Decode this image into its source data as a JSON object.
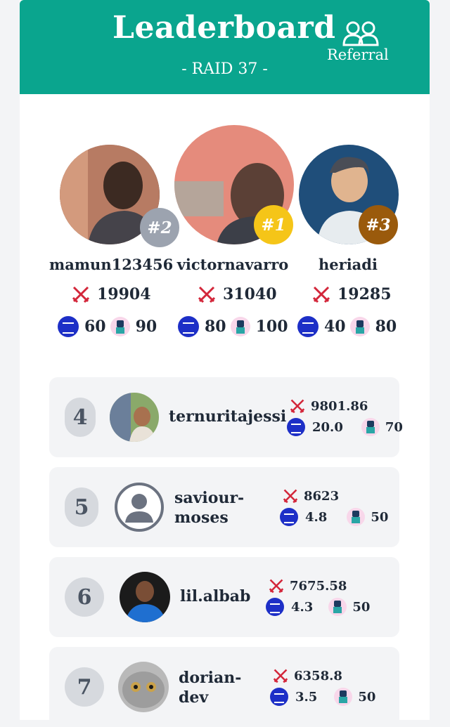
{
  "header": {
    "title": "Leaderboard",
    "subtitle": "- RAID 37 -",
    "referral_label": "Referral",
    "referral_icon": "users-icon",
    "color": "#0aa58e"
  },
  "podium": [
    {
      "rank_label": "#2",
      "name": "mamun123456",
      "damage": "19904",
      "steem": "60",
      "chars": "90",
      "badge_color": "#9ca3af"
    },
    {
      "rank_label": "#1",
      "name": "victornavarro",
      "damage": "31040",
      "steem": "80",
      "chars": "100",
      "badge_color": "#f5c518"
    },
    {
      "rank_label": "#3",
      "name": "heriadi",
      "damage": "19285",
      "steem": "40",
      "chars": "80",
      "badge_color": "#9a5a0c"
    }
  ],
  "rows": [
    {
      "rank": "4",
      "name_line1": "ternuritajessi",
      "name_line2": "",
      "damage": "9801.86",
      "steem": "20.0",
      "chars": "70"
    },
    {
      "rank": "5",
      "name_line1": "saviour-",
      "name_line2": "moses",
      "damage": "8623",
      "steem": "4.8",
      "chars": "50"
    },
    {
      "rank": "6",
      "name_line1": "lil.albab",
      "name_line2": "",
      "damage": "7675.58",
      "steem": "4.3",
      "chars": "50"
    },
    {
      "rank": "7",
      "name_line1": "dorian-",
      "name_line2": "dev",
      "damage": "6358.8",
      "steem": "3.5",
      "chars": "50"
    }
  ],
  "icons": {
    "damage": "crossed-swords-icon",
    "steem": "steem-coin-icon",
    "character": "character-icon",
    "default_avatar": "user-placeholder-icon"
  }
}
